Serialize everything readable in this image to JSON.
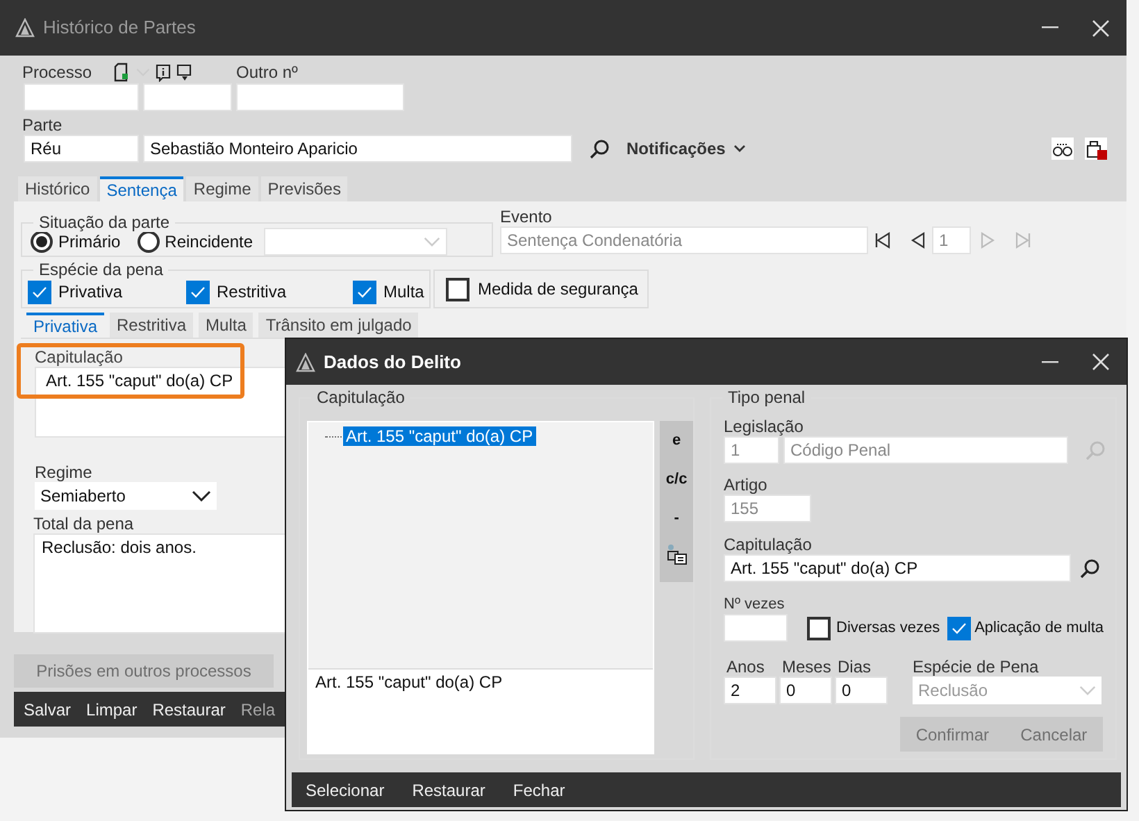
{
  "main_window": {
    "title": "Histórico de Partes"
  },
  "processo": {
    "label": "Processo",
    "other_label": "Outro nº"
  },
  "parte": {
    "label": "Parte",
    "type": "Réu",
    "name": "Sebastião Monteiro Aparicio",
    "notifications": "Notificações"
  },
  "tabs": [
    {
      "label": "Histórico",
      "selected": false
    },
    {
      "label": "Sentença",
      "selected": true
    },
    {
      "label": "Regime",
      "selected": false
    },
    {
      "label": "Previsões",
      "selected": false
    }
  ],
  "situacao": {
    "title": "Situação da parte",
    "options": [
      {
        "label": "Primário",
        "selected": true
      },
      {
        "label": "Reincidente",
        "selected": false
      }
    ]
  },
  "evento": {
    "label": "Evento",
    "value": "Sentença Condenatória",
    "page": "1"
  },
  "especie": {
    "title": "Espécie da pena",
    "options": [
      {
        "label": "Privativa",
        "checked": true
      },
      {
        "label": "Restritiva",
        "checked": true
      },
      {
        "label": "Multa",
        "checked": true
      }
    ],
    "medida": {
      "label": "Medida de segurança",
      "checked": false
    }
  },
  "sub_tabs": [
    {
      "label": "Privativa",
      "selected": true
    },
    {
      "label": "Restritiva",
      "selected": false
    },
    {
      "label": "Multa",
      "selected": false
    },
    {
      "label": "Trânsito em julgado",
      "selected": false
    }
  ],
  "capitulacao": {
    "label": "Capitulação",
    "value": "Art. 155 \"caput\" do(a) CP",
    "highlighted": true
  },
  "regime": {
    "label": "Regime",
    "value": "Semiaberto"
  },
  "total": {
    "label": "Total da pena",
    "value": "Reclusão: dois anos."
  },
  "prisoes_button": {
    "label": "Prisões em outros processos",
    "disabled": true
  },
  "footer": [
    {
      "label": "Salvar",
      "disabled": false
    },
    {
      "label": "Limpar",
      "disabled": false
    },
    {
      "label": "Restaurar",
      "disabled": false
    },
    {
      "label": "Rela",
      "disabled": true
    }
  ],
  "dialog": {
    "title": "Dados do Delito",
    "capitulacao_title": "Capitulação",
    "tree": [
      {
        "label": "Art. 155 \"caput\" do(a) CP",
        "selected": true
      }
    ],
    "preview": "Art. 155 \"caput\" do(a) CP",
    "side_buttons": [
      {
        "label": "e",
        "kind": "text"
      },
      {
        "label": "c/c",
        "kind": "text"
      },
      {
        "label": "-",
        "kind": "text"
      },
      {
        "kind": "icon"
      }
    ],
    "tipo_penal": {
      "title": "Tipo penal",
      "legislacao_label": "Legislação",
      "legislacao_code": "1",
      "legislacao_name": "Código Penal",
      "artigo_label": "Artigo",
      "artigo": "155",
      "capitulacao_label": "Capitulação",
      "capitulacao": "Art. 155 \"caput\" do(a) CP",
      "vezes_label": "Nº vezes",
      "diversas": {
        "label": "Diversas vezes",
        "checked": false
      },
      "multa": {
        "label": "Aplicação de multa",
        "checked": true
      },
      "anos_label": "Anos",
      "anos": "2",
      "meses_label": "Meses",
      "meses": "0",
      "dias_label": "Dias",
      "dias": "0",
      "especie_label": "Espécie de Pena",
      "especie": "Reclusão",
      "buttons": [
        {
          "label": "Confirmar",
          "disabled": true
        },
        {
          "label": "Cancelar",
          "disabled": true
        }
      ]
    },
    "footer": [
      "Selecionar",
      "Restaurar",
      "Fechar"
    ]
  }
}
